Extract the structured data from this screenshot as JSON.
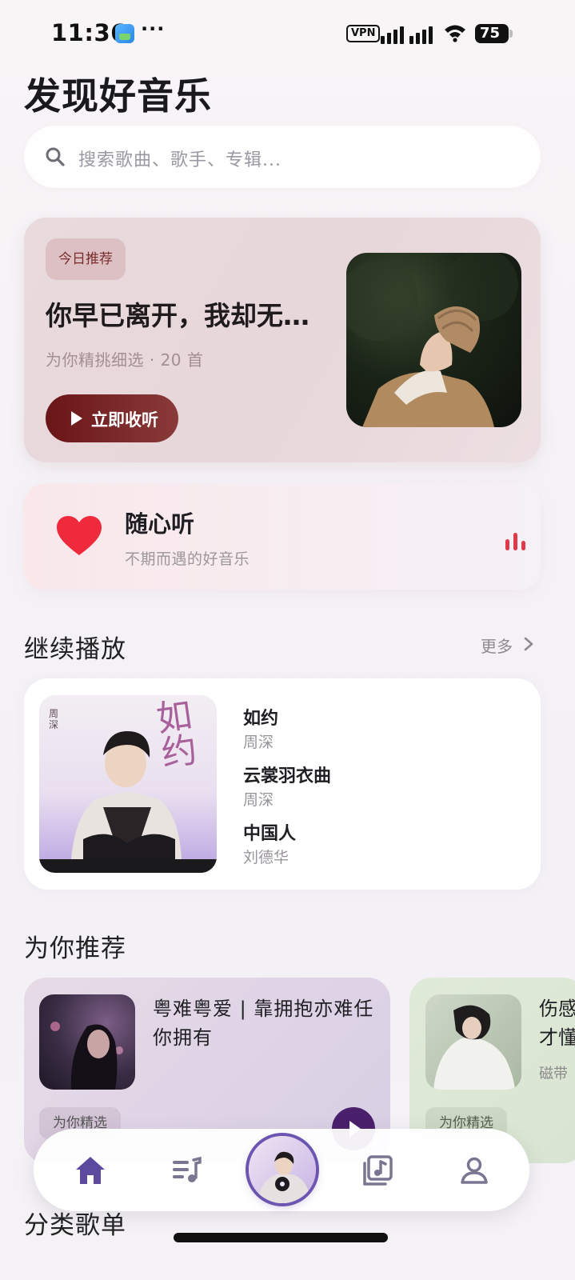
{
  "status_bar": {
    "time": "11:36",
    "dots": "···",
    "vpn": "VPN",
    "battery": "75"
  },
  "page_title": "发现好音乐",
  "search": {
    "placeholder": "搜索歌曲、歌手、专辑..."
  },
  "daily": {
    "badge": "今日推荐",
    "title": "你早已离开，我却无…",
    "meta": "为你精挑细选 · 20 首",
    "play_label": "立即收听"
  },
  "random_listen": {
    "title": "随心听",
    "subtitle": "不期而遇的好音乐"
  },
  "continue_playing": {
    "title": "继续播放",
    "more": "更多",
    "cover_text": {
      "big": "如约",
      "artist_vertical": "周深"
    },
    "songs": [
      {
        "title": "如约",
        "artist": "周深"
      },
      {
        "title": "云裳羽衣曲",
        "artist": "周深"
      },
      {
        "title": "中国人",
        "artist": "刘德华"
      }
    ]
  },
  "recommend": {
    "title": "为你推荐",
    "cards": [
      {
        "title": "粤难粤爱 | 靠拥抱亦难任你拥有",
        "badge": "为你精选"
      },
      {
        "title": "伤感\n才懂",
        "subtitle": "磁带",
        "badge": "为你精选"
      }
    ]
  },
  "categories_title": "分类歌单",
  "colors": {
    "accent_dark_red": "#6a1517",
    "heart_red": "#ee2a3c",
    "nav_purple": "#5b4a9e"
  },
  "nav": {
    "items": [
      "home-icon",
      "playlist-icon",
      "now-playing-disc",
      "library-icon",
      "profile-icon"
    ]
  }
}
